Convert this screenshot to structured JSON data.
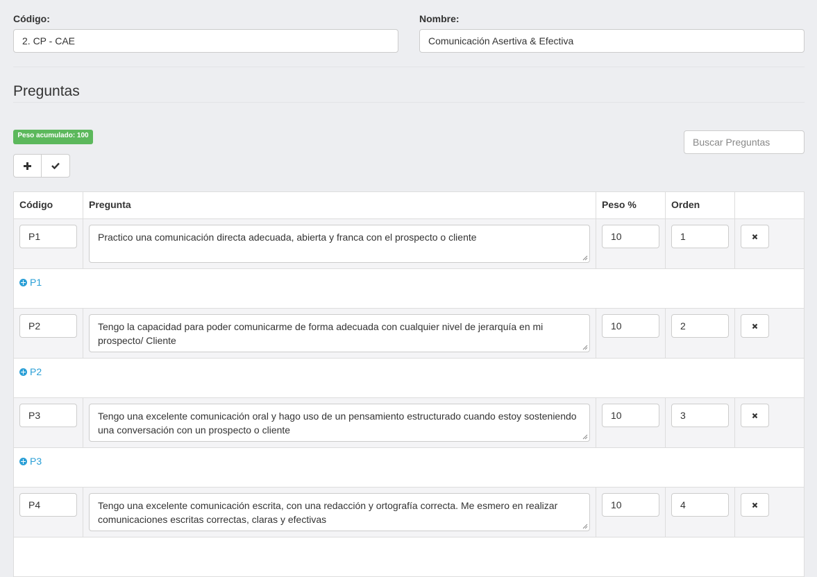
{
  "form": {
    "codigo_label": "Código:",
    "codigo_value": "2. CP - CAE",
    "nombre_label": "Nombre:",
    "nombre_value": "Comunicación Asertiva & Efectiva"
  },
  "section": {
    "title": "Preguntas",
    "badge": "Peso acumulado: 100",
    "search_placeholder": "Buscar Preguntas",
    "add_icon": "plus-icon",
    "confirm_icon": "check-icon"
  },
  "table": {
    "headers": [
      "Código",
      "Pregunta",
      "Peso %",
      "Orden",
      ""
    ],
    "rows": [
      {
        "codigo": "P1",
        "pregunta": "Practico una comunicación directa adecuada, abierta y franca con el prospecto o cliente",
        "peso": "10",
        "orden": "1",
        "link": "P1"
      },
      {
        "codigo": "P2",
        "pregunta": "Tengo la capacidad para poder comunicarme de forma adecuada con cualquier nivel de jerarquía en mi prospecto/ Cliente",
        "peso": "10",
        "orden": "2",
        "link": "P2"
      },
      {
        "codigo": "P3",
        "pregunta": "Tengo una excelente comunicación oral y hago uso de un pensamiento estructurado cuando estoy sosteniendo una conversación con un prospecto o cliente",
        "peso": "10",
        "orden": "3",
        "link": "P3"
      },
      {
        "codigo": "P4",
        "pregunta": "Tengo una excelente comunicación escrita, con una redacción y ortografía correcta. Me esmero en realizar comunicaciones escritas correctas, claras y efectivas",
        "peso": "10",
        "orden": "4",
        "link": "P4"
      }
    ]
  },
  "colors": {
    "badge": "#5cb85c",
    "link": "#2a9fd6",
    "background": "#edeef1"
  }
}
